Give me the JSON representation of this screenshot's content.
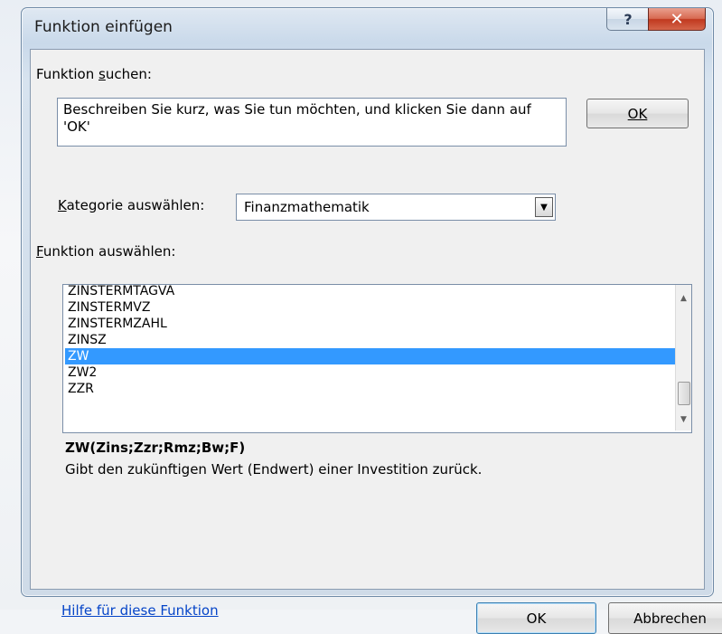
{
  "dialog": {
    "title": "Funktion einfügen",
    "help_glyph": "?",
    "close_glyph": "✕"
  },
  "search": {
    "label": "Funktion suchen:",
    "label_accel": "s",
    "value": "Beschreiben Sie kurz, was Sie tun möchten, und klicken Sie dann auf 'OK'",
    "ok_label": "OK"
  },
  "category": {
    "label": "Kategorie auswählen:",
    "selected": "Finanzmathematik",
    "arrow_glyph": "▼"
  },
  "functions": {
    "label": "Funktion auswählen:",
    "items": [
      {
        "name": "ZINSTERMTAGVA",
        "selected": false
      },
      {
        "name": "ZINSTERMVZ",
        "selected": false
      },
      {
        "name": "ZINSTERMZAHL",
        "selected": false
      },
      {
        "name": "ZINSZ",
        "selected": false
      },
      {
        "name": "ZW",
        "selected": true
      },
      {
        "name": "ZW2",
        "selected": false
      },
      {
        "name": "ZZR",
        "selected": false
      }
    ],
    "scroll_up_glyph": "▲",
    "scroll_down_glyph": "▼"
  },
  "details": {
    "signature": "ZW(Zins;Zzr;Rmz;Bw;F)",
    "description": "Gibt den zukünftigen Wert (Endwert) einer Investition zurück."
  },
  "footer": {
    "help_link": "Hilfe für diese Funktion",
    "ok_label": "OK",
    "cancel_label": "Abbrechen"
  },
  "colors": {
    "selection": "#3399ff",
    "link": "#0645c8",
    "close": "#c0391f"
  }
}
